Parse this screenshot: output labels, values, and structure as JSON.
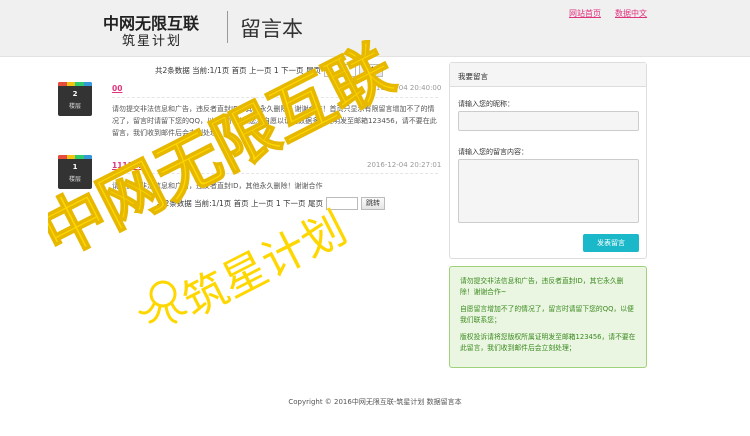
{
  "header": {
    "logo_main": "中网无限互联",
    "logo_sub": "筑星计划",
    "page_name": "留言本",
    "nav": [
      "网站首页",
      "数据中文"
    ]
  },
  "pager": {
    "summary": "共2条数据 当前:1/1页 首页 上一页 1 下一页 尾页",
    "jump_label": "跳转"
  },
  "messages": [
    {
      "number": "2",
      "floor": "楼层",
      "nickname": "00",
      "time": "2016-12-04 20:40:00",
      "body": "请勿提交非法信息和广告，违反者直封ID，其他永久删除！谢谢合作！首页只显示有限留言增加不了的情况了，留言时请留下您的QQ，以便我们联系您。自愿以证明数据多多证明发至邮箱123456，请不要在此留言，我们收到邮件后会立刻处理。"
    },
    {
      "number": "1",
      "floor": "楼层",
      "nickname": "111111",
      "time": "2016-12-04 20:27:01",
      "body": "请勿提交非法信息和广告，违反者直封ID，其他永久删除！谢谢合作"
    }
  ],
  "form": {
    "title": "我要留言",
    "nickname_label": "请输入您的昵称：",
    "content_label": "请输入您的留言内容：",
    "submit_label": "发表留言"
  },
  "notice": [
    "请勿提交非法信息和广告，违反者直封ID，其它永久删除！谢谢合作~",
    "自愿留言增加不了的情况了，留言时请留下您的QQ，以便我们联系您；",
    "版权投诉请将您版权所属证明发至邮箱123456，请不要在此留言，我们收到邮件后会立刻处理；"
  ],
  "footer": "Copyright © 2016中网无限互联-筑星计划 数据留言本",
  "watermark": {
    "line1": "中网无限互联",
    "line2": "筑星计划"
  },
  "colors": {
    "accent": "#e0337e",
    "button": "#1bb8c9",
    "notice_text": "#3b8a20",
    "watermark": "#ffd700"
  }
}
